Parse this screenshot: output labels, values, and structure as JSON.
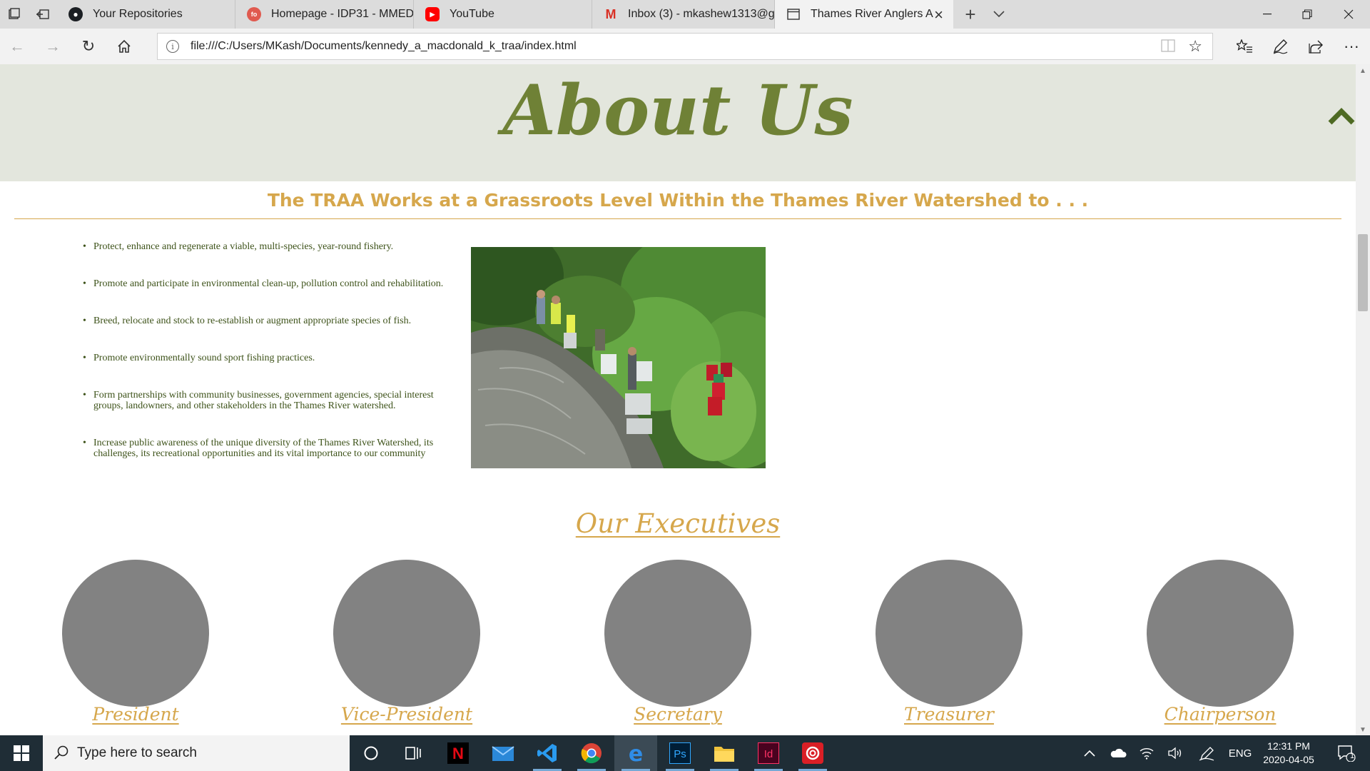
{
  "browser": {
    "tabs": [
      {
        "title": "Your Repositories",
        "icon": "github-icon"
      },
      {
        "title": "Homepage - IDP31 - MMED",
        "icon": "fol-icon"
      },
      {
        "title": "YouTube",
        "icon": "youtube-icon"
      },
      {
        "title": "Inbox (3) - mkashew1313@g",
        "icon": "gmail-icon"
      },
      {
        "title": "Thames River Anglers A",
        "icon": "page-icon",
        "active": true
      }
    ],
    "url": "file:///C:/Users/MKash/Documents/kennedy_a_macdonald_k_traa/index.html"
  },
  "page": {
    "about_title": "About Us",
    "subtitle": "The TRAA Works at a Grassroots Level Within the Thames River Watershed to . . .",
    "goals": [
      "Protect, enhance and regenerate a viable, multi-species, year-round fishery.",
      "Promote and participate in environmental clean-up, pollution control and rehabilitation.",
      "Breed, relocate and stock to re-establish or augment appropriate species of fish.",
      "Promote environmentally sound sport fishing practices.",
      "Form partnerships with community businesses, government agencies, special interest groups, landowners, and other stakeholders in the Thames River watershed.",
      "Increase public awareness of the unique diversity of the Thames River Watershed, its challenges, its recreational opportunities and its vital importance to our community"
    ],
    "executives_heading": "Our Executives",
    "executives": [
      "President",
      "Vice-President",
      "Secretary",
      "Treasurer",
      "Chairperson"
    ]
  },
  "taskbar": {
    "search_placeholder": "Type here to search",
    "language": "ENG",
    "time": "12:31 PM",
    "date": "2020-04-05",
    "notification_count": "1"
  },
  "colors": {
    "olive": "#6f8136",
    "gold": "#d6a74c",
    "band": "#e3e6dd",
    "text": "#3d5219"
  }
}
